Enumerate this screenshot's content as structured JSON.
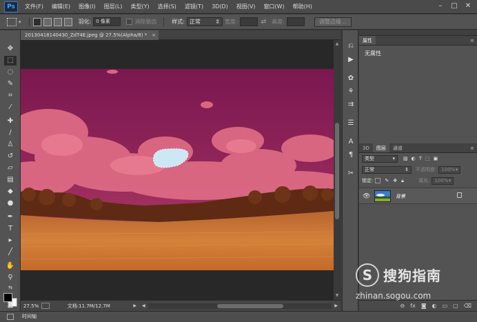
{
  "app": {
    "logo": "Ps"
  },
  "menu": [
    "文件(F)",
    "编辑(E)",
    "图像(I)",
    "图层(L)",
    "类型(Y)",
    "选择(S)",
    "滤镜(T)",
    "3D(D)",
    "视图(V)",
    "窗口(W)",
    "帮助(H)"
  ],
  "window_controls": {
    "minimize": "–",
    "restore": "□",
    "close": "✕"
  },
  "options": {
    "feather_label": "羽化:",
    "feather_value": "0 像素",
    "antialias_label": "消除锯齿",
    "style_label": "样式:",
    "style_value": "正常",
    "width_label": "宽度:",
    "height_label": "高度:",
    "refine_edge": "调整边缘..."
  },
  "document": {
    "tab_title": "20130418140430_ZdT4E.jpeg @ 27.5%(Alpha/8) *",
    "close": "×",
    "zoom": "27.5%",
    "doc_info": "文档:11.7M/12.7M"
  },
  "timeline": {
    "label": "时间轴"
  },
  "properties": {
    "tab": "属性",
    "body": "无属性"
  },
  "layers": {
    "tabs": [
      "3D",
      "图层",
      "通道"
    ],
    "active_tab": 1,
    "filter_kind": "类型",
    "blend_mode": "正常",
    "opacity_label": "不透明度:",
    "opacity_value": "100%",
    "lock_label": "锁定:",
    "fill_label": "填充:",
    "fill_value": "100%",
    "items": [
      {
        "name": "背景",
        "visible": true,
        "locked": true
      }
    ],
    "footer_icons": [
      "link-icon",
      "fx-icon",
      "mask-icon",
      "adjustment-icon",
      "folder-icon",
      "new-layer-icon",
      "trash-icon"
    ]
  },
  "tools": [
    "move-tool",
    "rectangular-marquee-tool",
    "lasso-tool",
    "quick-selection-tool",
    "crop-tool",
    "eyedropper-tool",
    "spot-healing-tool",
    "brush-tool",
    "clone-stamp-tool",
    "history-brush-tool",
    "eraser-tool",
    "gradient-tool",
    "blur-tool",
    "dodge-tool",
    "pen-tool",
    "type-tool",
    "path-selection-tool",
    "line-tool",
    "hand-tool",
    "zoom-tool"
  ],
  "watermark": {
    "logo": "S",
    "brand": "搜狗指南",
    "url": "zhinan.sogou.com"
  },
  "colors": {
    "sky_mask": "#8a1d55",
    "cloud_mask": "#e46a80",
    "field_mask": "#d07a34",
    "selection": "#cde8f5"
  }
}
